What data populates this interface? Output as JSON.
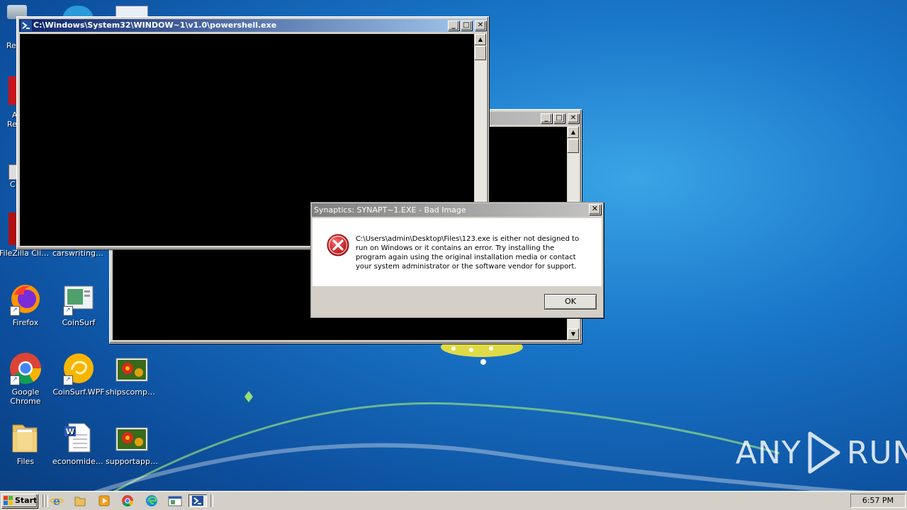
{
  "desktop": {
    "partial_labels": {
      "recycle": "Re",
      "acrobat_a": "A",
      "acrobat_re": "Re",
      "ccleaner": "C"
    },
    "icons": [
      {
        "label": "FileZilla Client",
        "icon": "filezilla-icon"
      },
      {
        "label": "carswriting.rtf",
        "icon": "rtf-document-icon"
      },
      {
        "label": "Firefox",
        "icon": "firefox-icon"
      },
      {
        "label": "CoinSurf",
        "icon": "coinsurf-icon"
      },
      {
        "label": "Google Chrome",
        "icon": "chrome-icon"
      },
      {
        "label": "CoinSurf.WPF",
        "icon": "coinsurf-wpf-icon"
      },
      {
        "label": "shipscompa...",
        "icon": "image-file-icon"
      },
      {
        "label": "Files",
        "icon": "folder-icon"
      },
      {
        "label": "economidef...",
        "icon": "word-document-icon"
      },
      {
        "label": "supportappr...",
        "icon": "image-file-icon"
      }
    ]
  },
  "powershell_window": {
    "title": "C:\\Windows\\System32\\WINDOW~1\\v1.0\\powershell.exe",
    "minimize": "_",
    "maximize": "□",
    "close": "✕"
  },
  "background_console": {
    "title": "",
    "minimize": "_",
    "maximize": "□",
    "close": "✕"
  },
  "error_dialog": {
    "title": "Synaptics: SYNAPT~1.EXE - Bad Image",
    "close": "✕",
    "message": "C:\\Users\\admin\\Desktop\\Files\\123.exe is either not designed to run on Windows or it contains an error. Try installing the program again using the original installation media or contact your system administrator or the software vendor for support.",
    "ok_label": "OK",
    "icon": "error-icon"
  },
  "taskbar": {
    "start_label": "Start",
    "quick_launch": [
      "ie-icon",
      "explorer-icon",
      "media-player-icon",
      "chrome-icon",
      "edge-icon",
      "window-icon",
      "powershell-icon"
    ],
    "clock": "6:57 PM"
  },
  "watermark": {
    "left": "ANY",
    "right": "RUN"
  },
  "colors": {
    "error_red": "#c4161c",
    "active_title": "#0a246a",
    "console_bg": "#000000"
  }
}
